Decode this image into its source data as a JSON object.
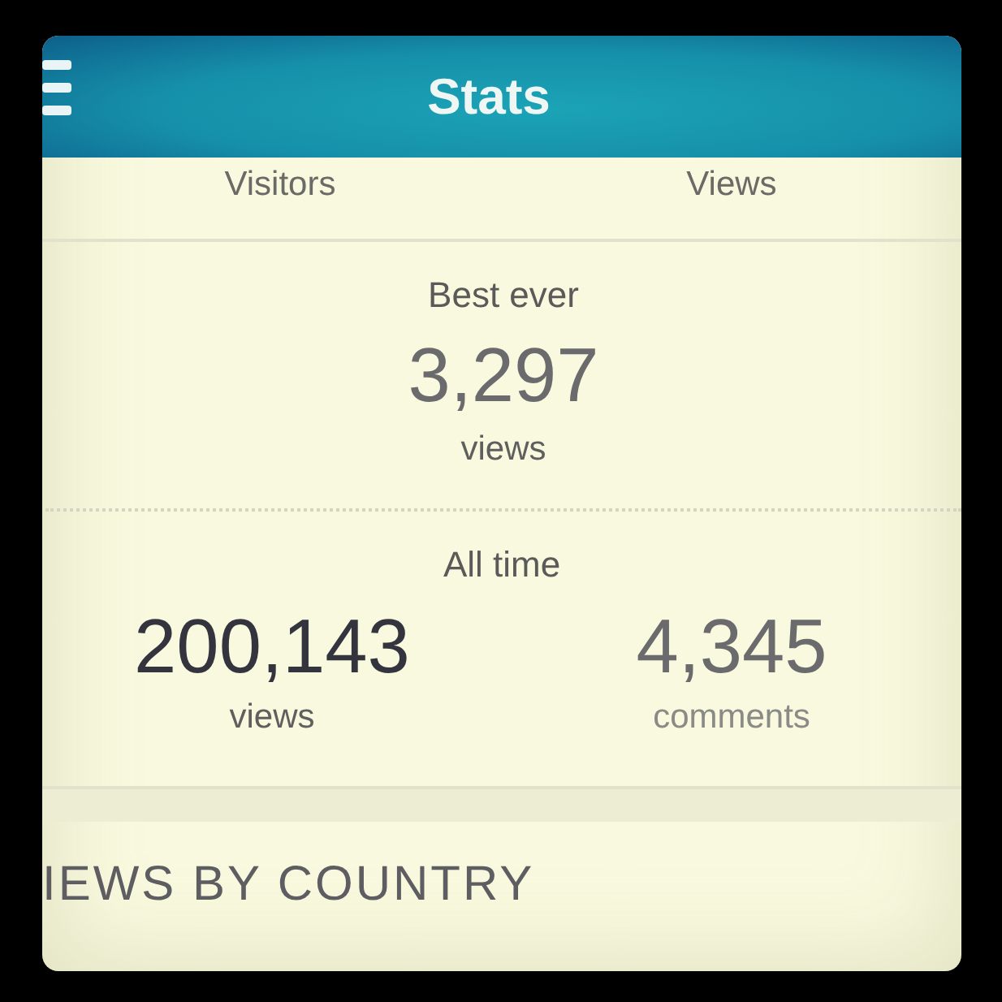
{
  "header": {
    "title": "Stats"
  },
  "legend": [
    "Visitors",
    "Views"
  ],
  "best_ever": {
    "label": "Best ever",
    "value": "3,297",
    "unit": "views"
  },
  "all_time": {
    "label": "All time",
    "stats": [
      {
        "value": "200,143",
        "unit": "views"
      },
      {
        "value": "4,345",
        "unit": "comments"
      }
    ]
  },
  "section": {
    "title": "IEWS BY COUNTRY"
  }
}
